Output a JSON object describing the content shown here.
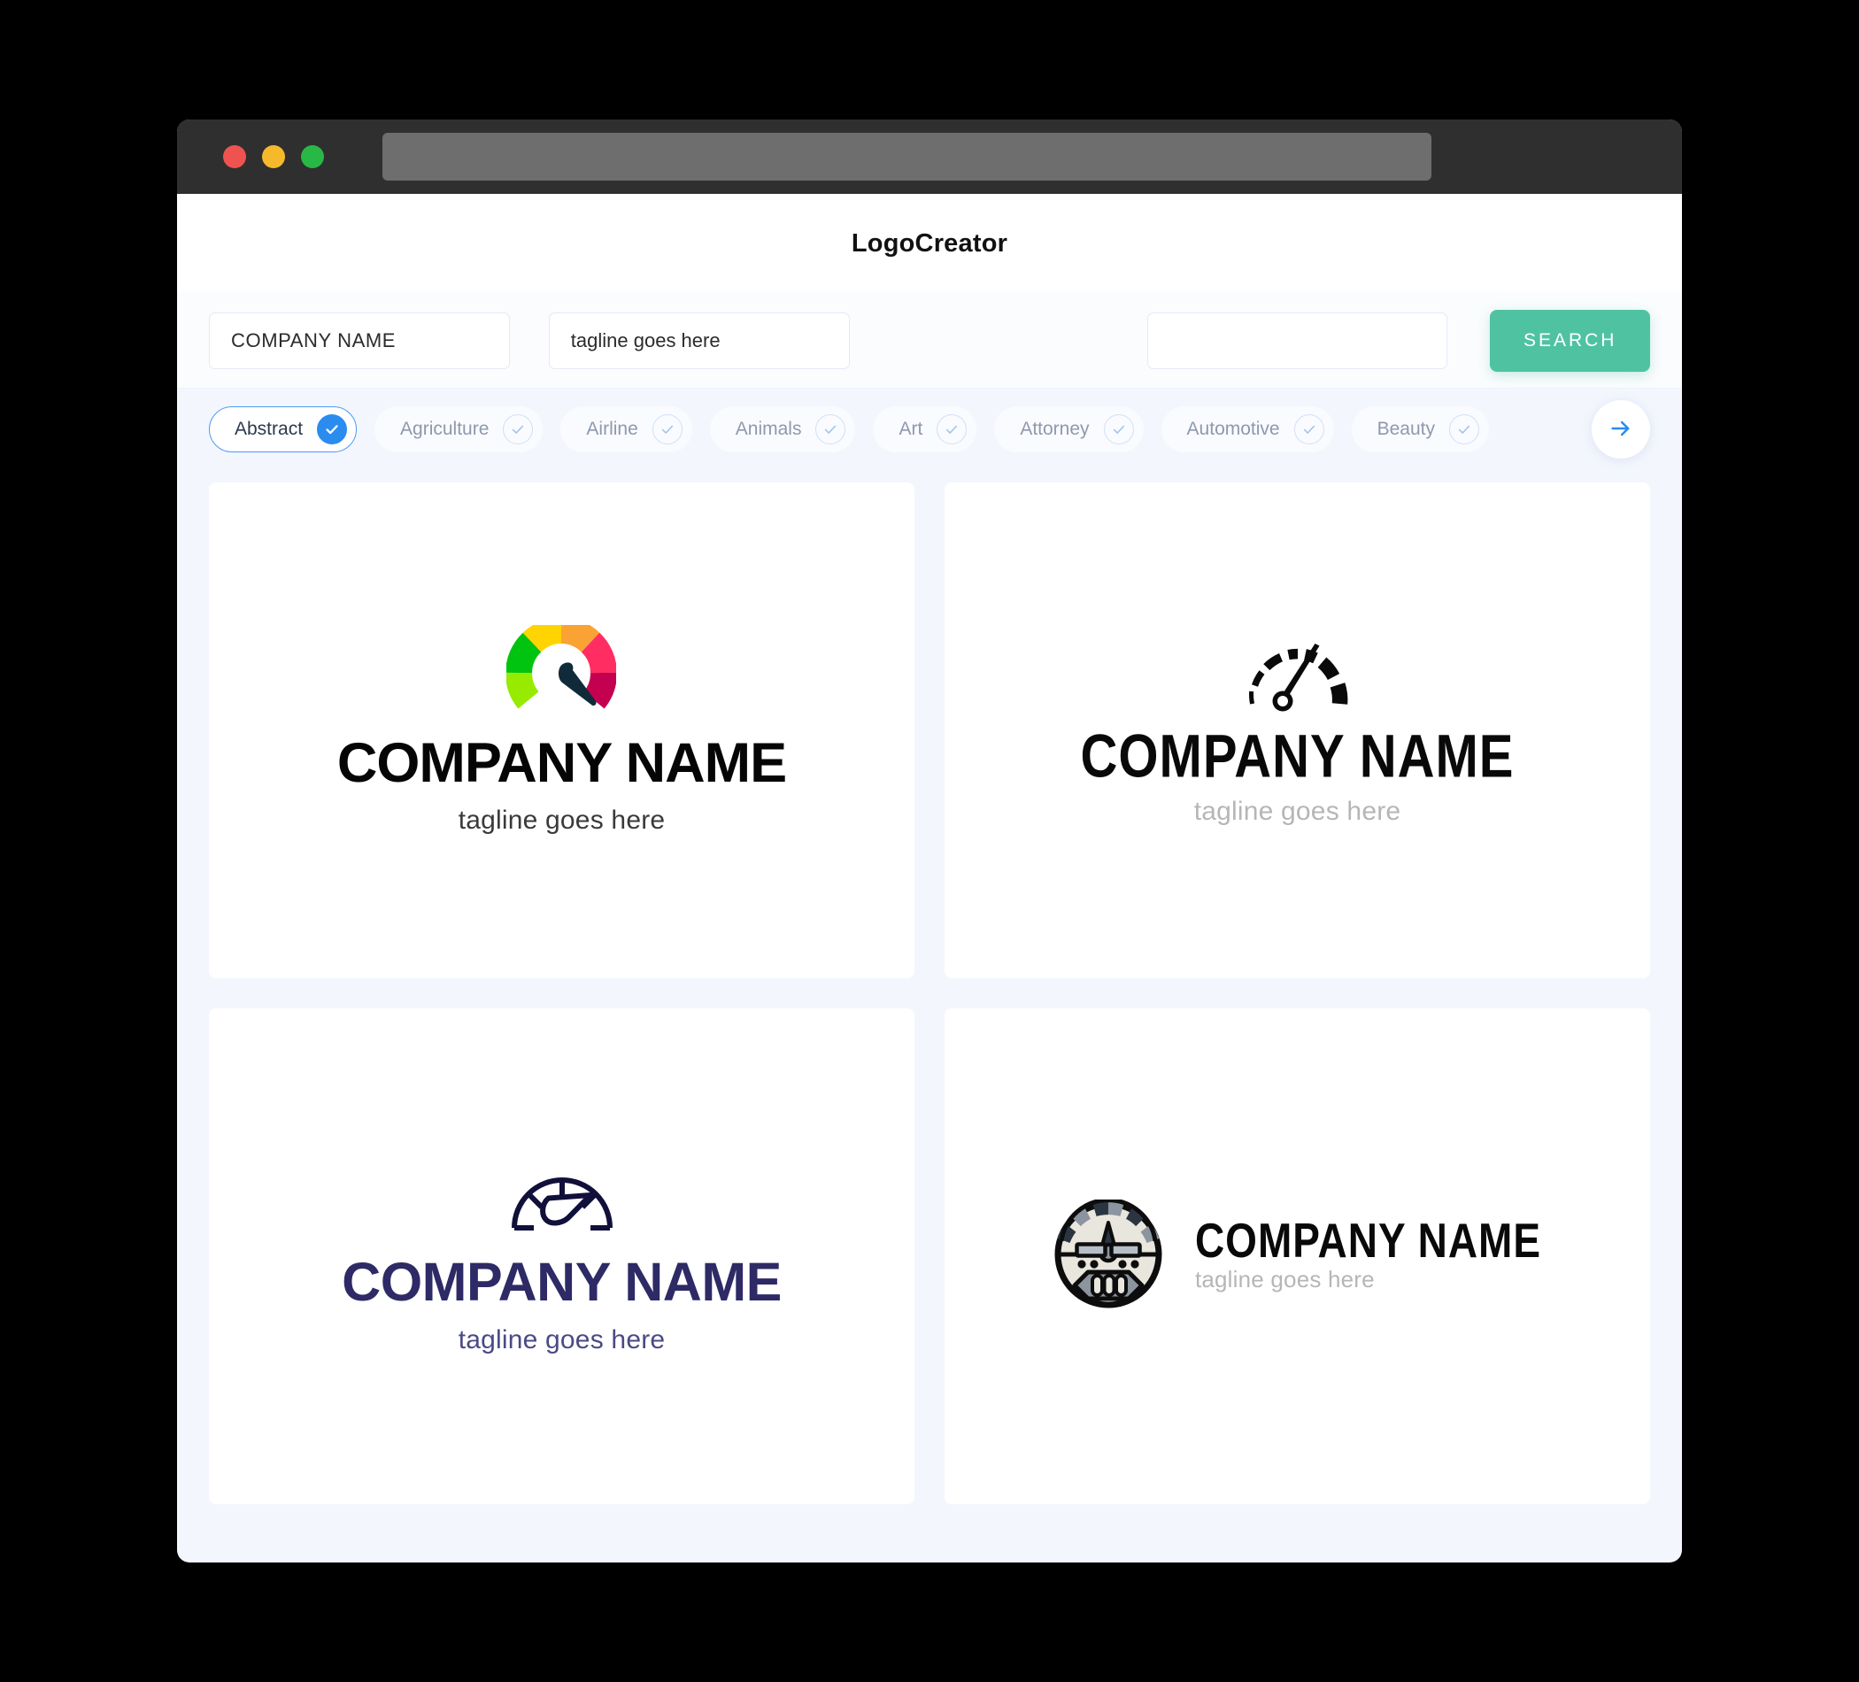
{
  "window": {
    "traffic_lights": [
      "close-red",
      "minimize-amber",
      "maximize-green"
    ],
    "url_value": ""
  },
  "header": {
    "title": "LogoCreator"
  },
  "toolbar": {
    "company_value": "COMPANY NAME",
    "company_placeholder": "COMPANY NAME",
    "tagline_value": "tagline goes here",
    "tagline_placeholder": "tagline goes here",
    "extra_value": "",
    "extra_placeholder": "",
    "search_label": "SEARCH",
    "search_color": "#4fc3a1"
  },
  "categories": {
    "active_index": 0,
    "active_color": "#2b8cf0",
    "items": [
      {
        "label": "Abstract",
        "selected": true
      },
      {
        "label": "Agriculture",
        "selected": false
      },
      {
        "label": "Airline",
        "selected": false
      },
      {
        "label": "Animals",
        "selected": false
      },
      {
        "label": "Art",
        "selected": false
      },
      {
        "label": "Attorney",
        "selected": false
      },
      {
        "label": "Automotive",
        "selected": false
      },
      {
        "label": "Beauty",
        "selected": false
      }
    ],
    "next_icon": "arrow-right-icon"
  },
  "results": [
    {
      "id": "logo-1",
      "mark": "colorful-gauge-icon",
      "layout": "stacked",
      "name": "COMPANY NAME",
      "tagline": "tagline goes here",
      "name_color": "#050505",
      "tagline_color": "#3a3a3a",
      "mark_colors": {
        "orange": "#fba234",
        "yellow": "#ffd400",
        "green": "#00c40f",
        "lime": "#96eb00",
        "pink": "#ff2d62",
        "crimson": "#c40050",
        "needle": "#102a3a"
      }
    },
    {
      "id": "logo-2",
      "mark": "solid-speedometer-icon",
      "layout": "stacked",
      "name": "COMPANY NAME",
      "tagline": "tagline goes here",
      "name_color": "#090909",
      "tagline_color": "#b6b6b6",
      "mark_colors": {
        "primary": "#0a0a0a"
      }
    },
    {
      "id": "logo-3",
      "mark": "outline-speedometer-icon",
      "layout": "stacked",
      "name": "COMPANY NAME",
      "tagline": "tagline goes here",
      "name_color": "#2d2a66",
      "tagline_color": "#4a4a86",
      "mark_colors": {
        "primary": "#10103a"
      }
    },
    {
      "id": "logo-4",
      "mark": "dashboard-badge-icon",
      "layout": "horizontal",
      "name": "COMPANY NAME",
      "tagline": "tagline goes here",
      "name_color": "#090909",
      "tagline_color": "#b6b6b6",
      "mark_colors": {
        "outline": "#0d0d0d",
        "face": "#e8e6dd",
        "dark": "#2b3542",
        "mid": "#8b949f",
        "light": "#b7bec7"
      }
    }
  ],
  "theme": {
    "page_bg": "#f3f6fd",
    "card_bg": "#ffffff",
    "titlebar_bg": "#2f2f2f",
    "field_border": "#e3eaf6"
  }
}
